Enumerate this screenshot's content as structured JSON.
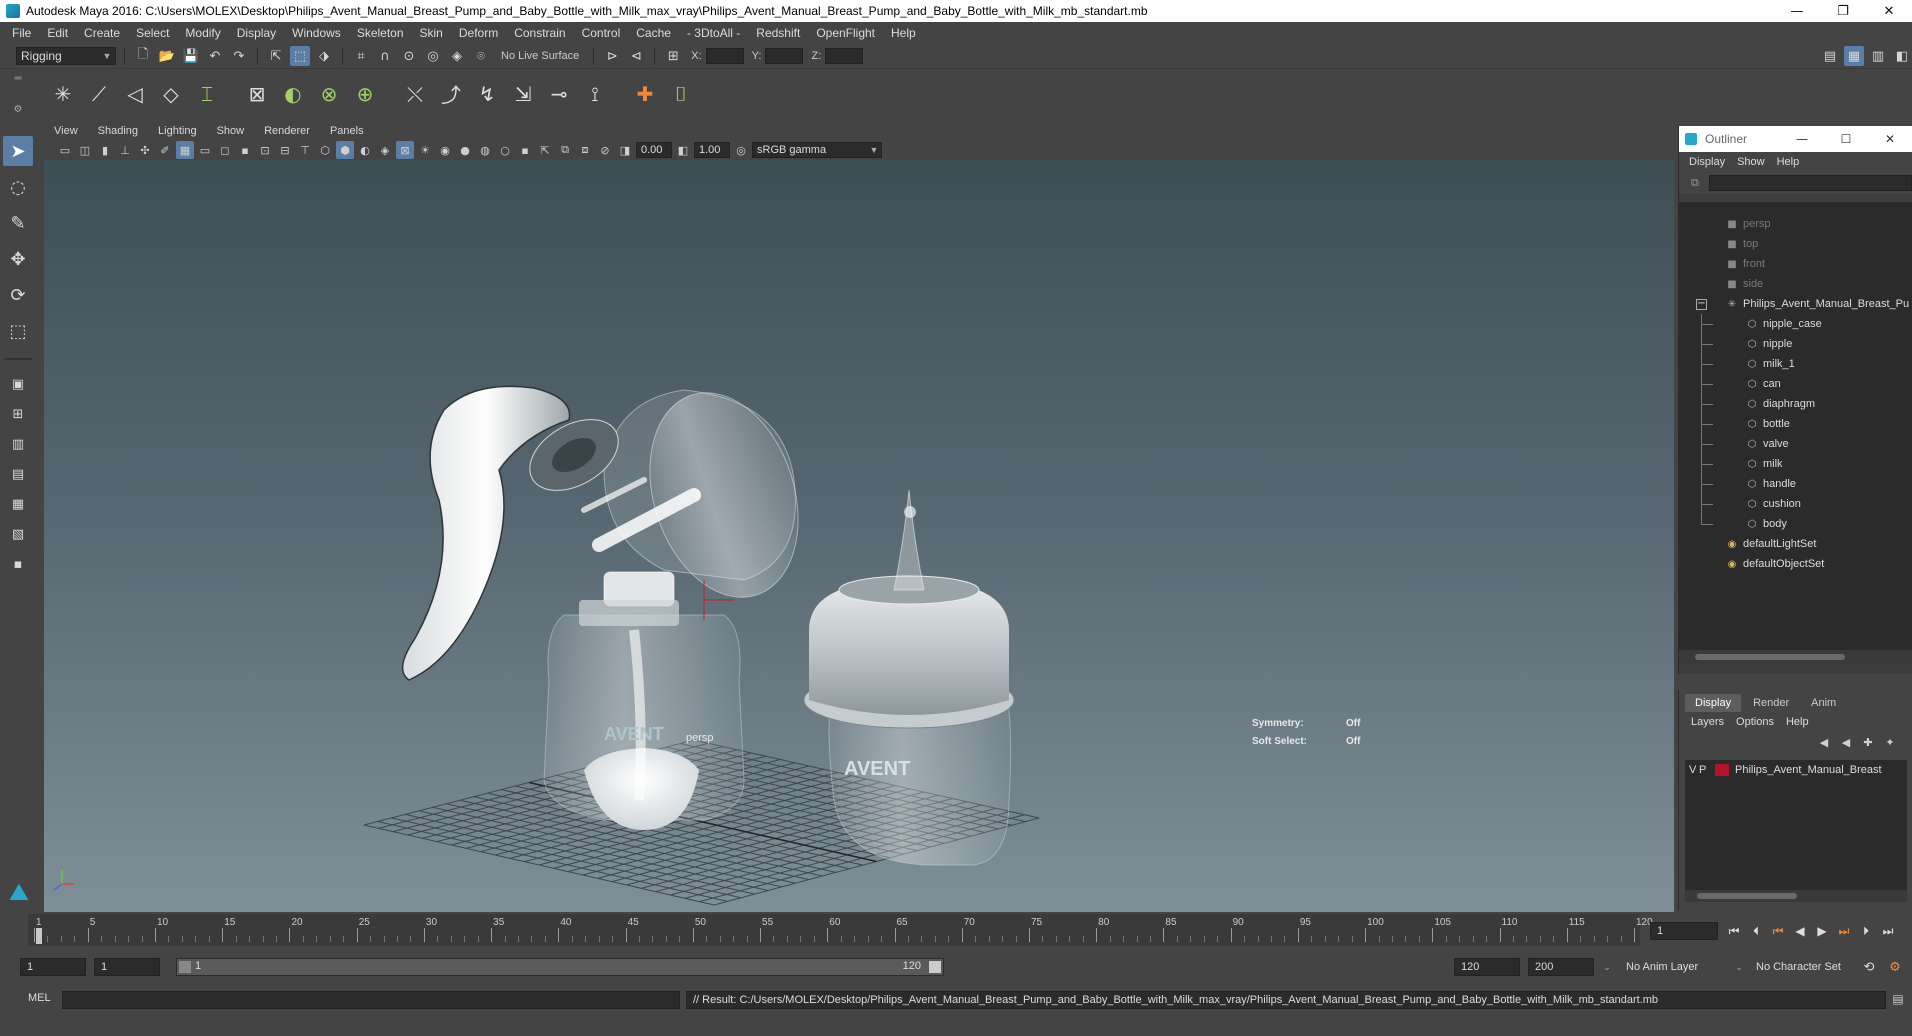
{
  "window": {
    "title": "Autodesk Maya 2016: C:\\Users\\MOLEX\\Desktop\\Philips_Avent_Manual_Breast_Pump_and_Baby_Bottle_with_Milk_max_vray\\Philips_Avent_Manual_Breast_Pump_and_Baby_Bottle_with_Milk_mb_standart.mb",
    "minimize": "—",
    "restore": "❐",
    "close": "✕"
  },
  "menu": [
    "File",
    "Edit",
    "Create",
    "Select",
    "Modify",
    "Display",
    "Windows",
    "Skeleton",
    "Skin",
    "Deform",
    "Constrain",
    "Control",
    "Cache",
    "- 3DtoAll -",
    "Redshift",
    "OpenFlight",
    "Help"
  ],
  "status": {
    "mode": "Rigging",
    "live_surface": "No Live Surface",
    "x_label": "X:",
    "y_label": "Y:",
    "z_label": "Z:"
  },
  "panel": {
    "menu": [
      "View",
      "Shading",
      "Lighting",
      "Show",
      "Renderer",
      "Panels"
    ],
    "near": "0.00",
    "far": "1.00",
    "color_space": "sRGB gamma"
  },
  "viewport": {
    "camera": "persp",
    "symmetry_label": "Symmetry:",
    "symmetry_value": "Off",
    "soft_select_label": "Soft Select:",
    "soft_select_value": "Off",
    "bottle_text_1": "AVENT",
    "bottle_text_2": "AVENT"
  },
  "outliner": {
    "title": "Outliner",
    "menu": [
      "Display",
      "Show",
      "Help"
    ],
    "cameras": [
      "persp",
      "top",
      "front",
      "side"
    ],
    "group": "Philips_Avent_Manual_Breast_Pu",
    "children": [
      "nipple_case",
      "nipple",
      "milk_1",
      "can",
      "diaphragm",
      "bottle",
      "valve",
      "milk",
      "handle",
      "cushion",
      "body"
    ],
    "sets": [
      "defaultLightSet",
      "defaultObjectSet"
    ]
  },
  "layer_editor": {
    "tabs": [
      "Display",
      "Render",
      "Anim"
    ],
    "menu": [
      "Layers",
      "Options",
      "Help"
    ],
    "layer_v": "V",
    "layer_p": "P",
    "layer_name": "Philips_Avent_Manual_Breast"
  },
  "timeline": {
    "ticks": [
      "1",
      "5",
      "10",
      "15",
      "20",
      "25",
      "30",
      "35",
      "40",
      "45",
      "50",
      "55",
      "60",
      "65",
      "70",
      "75",
      "80",
      "85",
      "90",
      "95",
      "100",
      "105",
      "110",
      "115",
      "120"
    ],
    "current_frame": "1"
  },
  "range": {
    "start": "1",
    "playback_start": "1",
    "inner_start": "1",
    "inner_end": "120",
    "playback_end": "120",
    "end": "200",
    "anim_layer": "No Anim Layer",
    "character_set": "No Character Set"
  },
  "command": {
    "language": "MEL",
    "result": "// Result: C:/Users/MOLEX/Desktop/Philips_Avent_Manual_Breast_Pump_and_Baby_Bottle_with_Milk_max_vray/Philips_Avent_Manual_Breast_Pump_and_Baby_Bottle_with_Milk_mb_standart.mb"
  },
  "colors": {
    "accent": "#5b7fa4",
    "layer_swatch": "#b3162a"
  }
}
